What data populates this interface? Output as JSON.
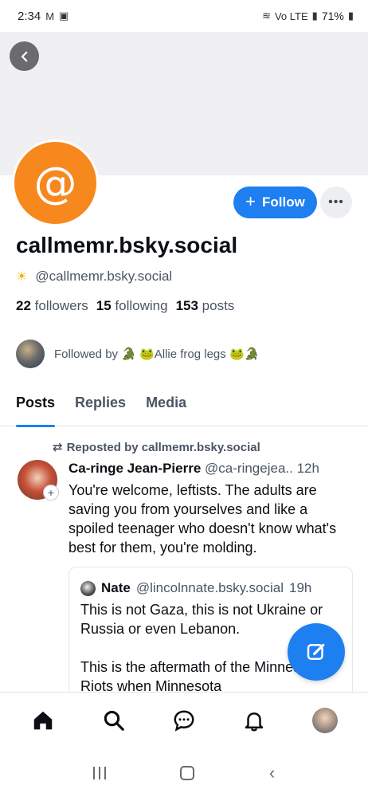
{
  "status_bar": {
    "time": "2:34",
    "battery": "71%",
    "network": "Vo LTE"
  },
  "profile": {
    "display_name": "callmemr.bsky.social",
    "handle": "@callmemr.bsky.social",
    "followers_count": "22",
    "followers_label": "followers",
    "following_count": "15",
    "following_label": "following",
    "posts_count": "153",
    "posts_label": "posts",
    "followed_by_text": "Followed by 🐊 🐸Allie frog legs 🐸🐊",
    "follow_label": "Follow"
  },
  "tabs": [
    {
      "label": "Posts",
      "active": true
    },
    {
      "label": "Replies",
      "active": false
    },
    {
      "label": "Media",
      "active": false
    }
  ],
  "post": {
    "repost_label": "Reposted by callmemr.bsky.social",
    "author": "Ca-ringe Jean-Pierre",
    "handle": "@ca-ringejea..",
    "time": "12h",
    "text": "You're welcome, leftists. The adults are saving you from yourselves and like a spoiled teenager who doesn't know what's best for them, you're molding.",
    "quote": {
      "author": "Nate",
      "handle": "@lincolnnate.bsky.social",
      "time": "19h",
      "text_p1": "This is not Gaza, this is not Ukraine or Russia or even Lebanon.",
      "text_p2": "This is the aftermath of the Minneapolis Riots when Minnesota"
    }
  },
  "colors": {
    "accent": "#1d7ff0",
    "avatar": "#f7881e",
    "muted_text": "#4a5564"
  }
}
